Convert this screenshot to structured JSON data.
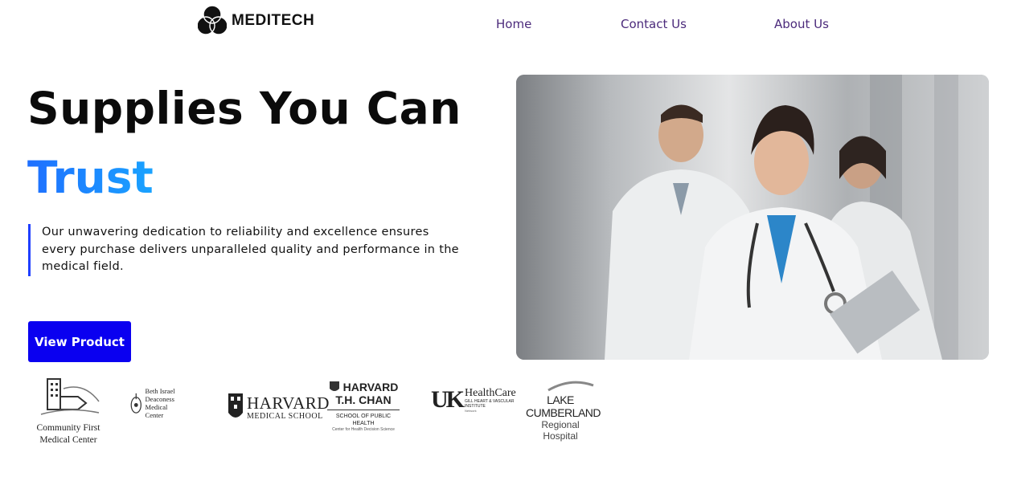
{
  "header": {
    "brand": "MEDITECH",
    "nav": [
      {
        "label": "Home"
      },
      {
        "label": "Contact Us"
      },
      {
        "label": "About Us"
      }
    ]
  },
  "hero": {
    "title_line1": "Supplies You Can",
    "title_line2": "Trust",
    "description": "Our unwavering dedication to reliability and excellence ensures every purchase delivers unparalleled quality and performance in the medical field.",
    "cta_label": "View Product"
  },
  "partners": [
    {
      "lines": [
        "Community First",
        "Medical Center"
      ]
    },
    {
      "lines": [
        "Beth Israel Deaconess",
        "Medical Center"
      ]
    },
    {
      "lines": [
        "HARVARD",
        "MEDICAL SCHOOL"
      ]
    },
    {
      "lines": [
        "HARVARD",
        "T.H. CHAN",
        "SCHOOL OF PUBLIC HEALTH",
        "Center for Health Decision Science"
      ]
    },
    {
      "lines": [
        "UK",
        "HealthCare",
        "GILL HEART & VASCULAR INSTITUTE",
        "Network"
      ]
    },
    {
      "lines": [
        "LAKE CUMBERLAND",
        "Regional Hospital"
      ]
    }
  ],
  "colors": {
    "nav_text": "#4b2a7b",
    "cta_bg": "#0a00f0",
    "accent_gradient_start": "#1e6fff",
    "accent_gradient_end": "#1aa3ff",
    "quote_bar": "#1f3fff"
  }
}
